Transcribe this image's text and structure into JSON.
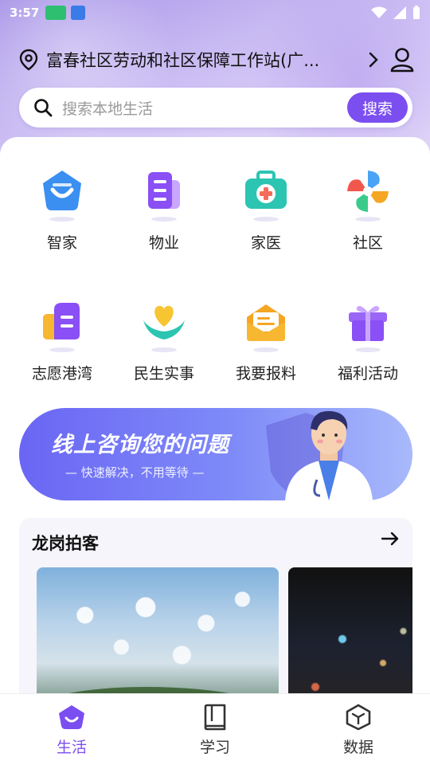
{
  "status_bar": {
    "time": "3:57",
    "mini_app_a": "app-badge-green",
    "mini_app_b": "app-badge-blue"
  },
  "header": {
    "location": "富春社区劳动和社区保障工作站(广...",
    "search_placeholder": "搜索本地生活",
    "search_button": "搜索"
  },
  "services": [
    {
      "label": "智家",
      "icon": "smart-home-icon"
    },
    {
      "label": "物业",
      "icon": "property-icon"
    },
    {
      "label": "家医",
      "icon": "family-doctor-icon"
    },
    {
      "label": "社区",
      "icon": "community-icon"
    },
    {
      "label": "志愿港湾",
      "icon": "volunteer-icon"
    },
    {
      "label": "民生实事",
      "icon": "livelihood-icon"
    },
    {
      "label": "我要报料",
      "icon": "report-icon"
    },
    {
      "label": "福利活动",
      "icon": "welfare-gift-icon"
    }
  ],
  "banner": {
    "title": "线上咨询您的问题",
    "subtitle": "— 快速解决，不用等待 —"
  },
  "feed": {
    "title": "龙岗拍客"
  },
  "bottom_nav": [
    {
      "label": "生活",
      "active": true
    },
    {
      "label": "学习",
      "active": false
    },
    {
      "label": "数据",
      "active": false
    }
  ],
  "colors": {
    "accent": "#7b4ef0",
    "banner_start": "#6a66f4",
    "banner_end": "#a8b9fb"
  }
}
